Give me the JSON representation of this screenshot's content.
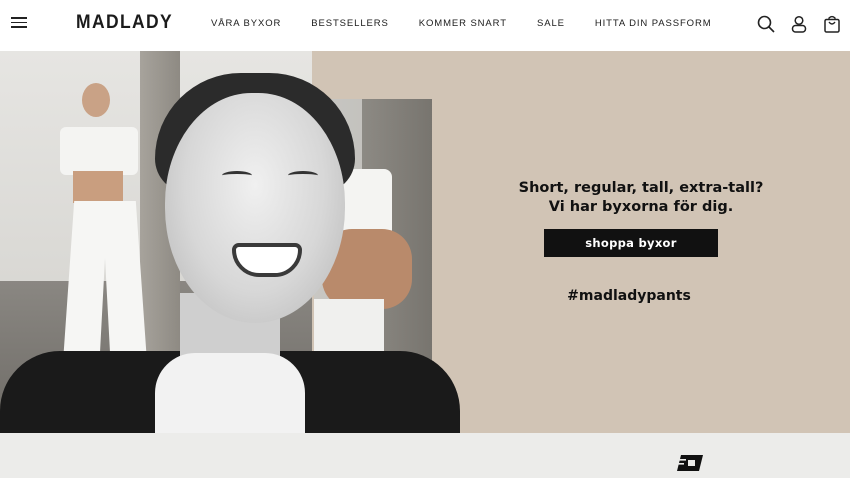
{
  "header": {
    "logo": "MADLADY",
    "nav": [
      "VÅRA BYXOR",
      "BESTSELLERS",
      "KOMMER SNART",
      "SALE",
      "HITTA DIN PASSFORM"
    ]
  },
  "icons": {
    "menu": "hamburger-menu-icon",
    "search": "search-icon",
    "account": "user-icon",
    "cart": "shopping-bag-icon",
    "delivery": "delivery-truck-icon"
  },
  "hero": {
    "headline_line1": "Short, regular, tall, extra-tall?",
    "headline_line2": "Vi har byxorna för dig.",
    "cta": "shoppa byxor",
    "hashtag": "#madladypants",
    "background_color": "#d1c4b5"
  }
}
